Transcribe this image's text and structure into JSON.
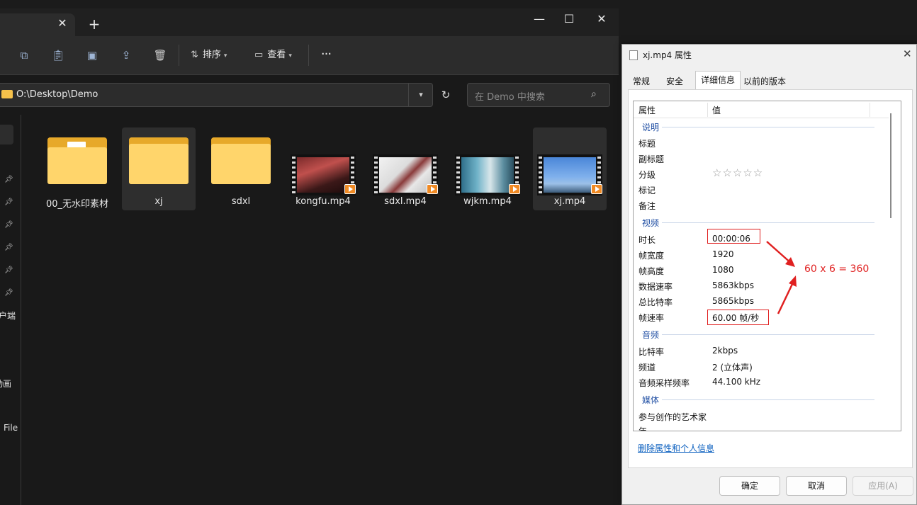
{
  "explorer": {
    "tab": {
      "close_glyph": "✕",
      "add_glyph": "+"
    },
    "window_controls": {
      "minimize": "—",
      "maximize": "☐",
      "close": "✕"
    },
    "toolbar": {
      "sort_label": "排序",
      "view_label": "查看",
      "more_label": "···"
    },
    "address": "O:\\Desktop\\Demo",
    "search_placeholder": "在 Demo 中搜索",
    "nav_partial_labels": [
      "客户端",
      "动画",
      "File"
    ],
    "files": [
      {
        "name": "00_无水印素材",
        "type": "folder",
        "selected": false
      },
      {
        "name": "xj",
        "type": "folder",
        "selected": true
      },
      {
        "name": "sdxl",
        "type": "folder",
        "selected": false
      },
      {
        "name": "kongfu.mp4",
        "type": "video",
        "selected": false
      },
      {
        "name": "sdxl.mp4",
        "type": "video",
        "selected": false
      },
      {
        "name": "wjkm.mp4",
        "type": "video",
        "selected": false
      },
      {
        "name": "xj.mp4",
        "type": "video",
        "selected": true
      }
    ]
  },
  "dialog": {
    "title": "xj.mp4 属性",
    "close_glyph": "✕",
    "tabs": [
      "常规",
      "安全",
      "详细信息",
      "以前的版本"
    ],
    "active_tab": "详细信息",
    "columns": {
      "property": "属性",
      "value": "值"
    },
    "groups": {
      "description": "说明",
      "video": "视频",
      "audio": "音频",
      "media": "媒体"
    },
    "description_rows": [
      {
        "key": "标题",
        "value": ""
      },
      {
        "key": "副标题",
        "value": ""
      },
      {
        "key": "分级",
        "value": ""
      },
      {
        "key": "标记",
        "value": ""
      },
      {
        "key": "备注",
        "value": ""
      }
    ],
    "rating_stars": "☆☆☆☆☆",
    "video_rows": [
      {
        "key": "时长",
        "value": "00:00:06"
      },
      {
        "key": "帧宽度",
        "value": "1920"
      },
      {
        "key": "帧高度",
        "value": "1080"
      },
      {
        "key": "数据速率",
        "value": "5863kbps"
      },
      {
        "key": "总比特率",
        "value": "5865kbps"
      },
      {
        "key": "帧速率",
        "value": "60.00 帧/秒"
      }
    ],
    "audio_rows": [
      {
        "key": "比特率",
        "value": "2kbps"
      },
      {
        "key": "频道",
        "value": "2 (立体声)"
      },
      {
        "key": "音频采样频率",
        "value": "44.100 kHz"
      }
    ],
    "media_rows": [
      {
        "key": "参与创作的艺术家",
        "value": ""
      },
      {
        "key": "年",
        "value": ""
      }
    ],
    "annotation": "60 x 6 = 360",
    "remove_link": "删除属性和个人信息",
    "buttons": {
      "ok": "确定",
      "cancel": "取消",
      "apply": "应用(A)"
    }
  },
  "colors": {
    "annotation_red": "#e02020",
    "link_blue": "#0a5fbf",
    "group_blue": "#1f4ea3",
    "folder_yellow": "#ffd56b"
  }
}
